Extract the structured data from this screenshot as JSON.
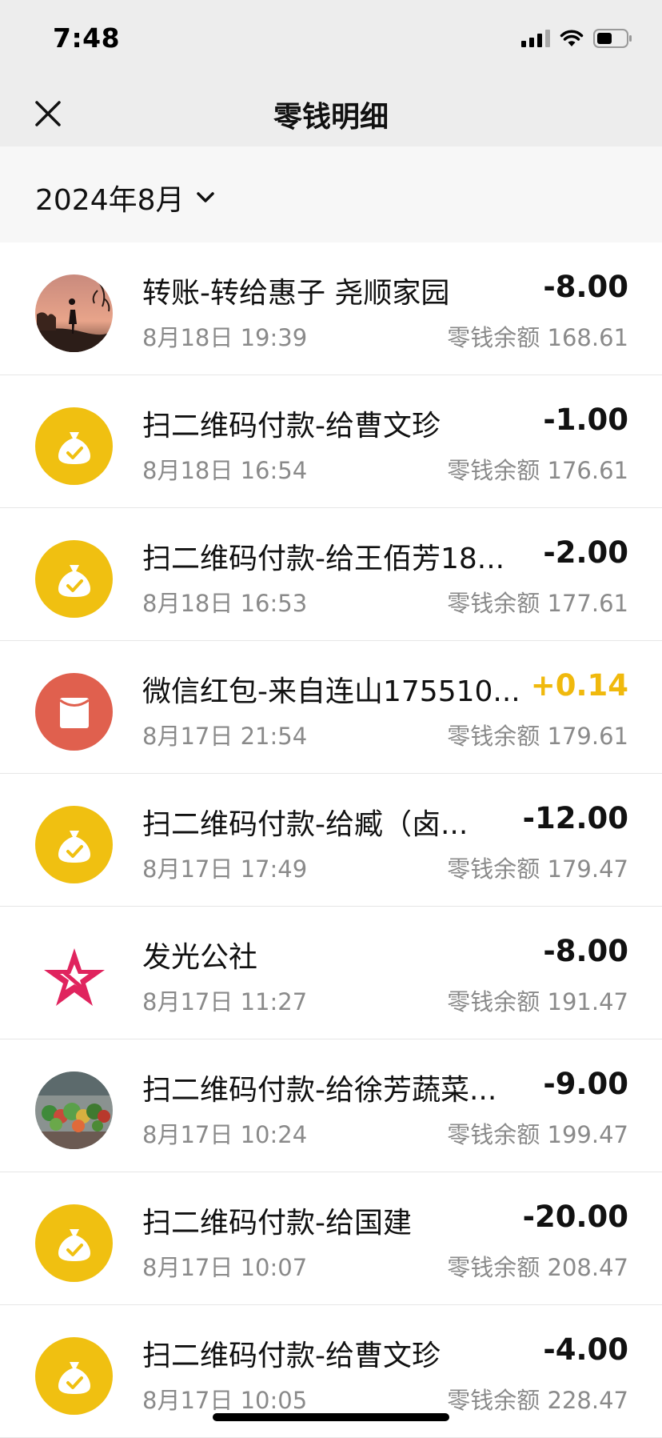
{
  "status": {
    "time": "7:48",
    "icons": [
      "signal-icon",
      "wifi-icon",
      "battery-icon"
    ]
  },
  "nav": {
    "title": "零钱明细",
    "close_icon": "close-icon"
  },
  "filter": {
    "month": "2024年8月"
  },
  "colors": {
    "payment_icon_bg": "#f0c011",
    "redpacket_icon_bg": "#e0604e",
    "income_amount": "#f0b90d",
    "secondary_text": "#8a8a8a"
  },
  "transactions": [
    {
      "avatar": "photo-avatar-sunset",
      "title": "转账-转给惠子 尧顺家园",
      "date": "8月18日 19:39",
      "amount": "-8.00",
      "balance": "零钱余额 168.61"
    },
    {
      "avatar": "money-bag-icon",
      "title": "扫二维码付款-给曹文珍",
      "date": "8月18日 16:54",
      "amount": "-1.00",
      "balance": "零钱余额 176.61"
    },
    {
      "avatar": "money-bag-icon",
      "title": "扫二维码付款-给王佰芳18...",
      "date": "8月18日 16:53",
      "amount": "-2.00",
      "balance": "零钱余额 177.61"
    },
    {
      "avatar": "red-packet-icon",
      "title": "微信红包-来自连山175510...",
      "date": "8月17日 21:54",
      "amount": "+0.14",
      "balance": "零钱余额 179.61"
    },
    {
      "avatar": "money-bag-icon",
      "title": "扫二维码付款-给臧（卤...",
      "date": "8月17日 17:49",
      "amount": "-12.00",
      "balance": "零钱余额 179.47"
    },
    {
      "avatar": "star-logo-icon",
      "title": "发光公社",
      "date": "8月17日 11:27",
      "amount": "-8.00",
      "balance": "零钱余额 191.47"
    },
    {
      "avatar": "photo-avatar-vegetables",
      "title": "扫二维码付款-给徐芳蔬菜...",
      "date": "8月17日 10:24",
      "amount": "-9.00",
      "balance": "零钱余额 199.47"
    },
    {
      "avatar": "money-bag-icon",
      "title": "扫二维码付款-给国建",
      "date": "8月17日 10:07",
      "amount": "-20.00",
      "balance": "零钱余额 208.47"
    },
    {
      "avatar": "money-bag-icon",
      "title": "扫二维码付款-给曹文珍",
      "date": "8月17日 10:05",
      "amount": "-4.00",
      "balance": "零钱余额 228.47"
    }
  ]
}
